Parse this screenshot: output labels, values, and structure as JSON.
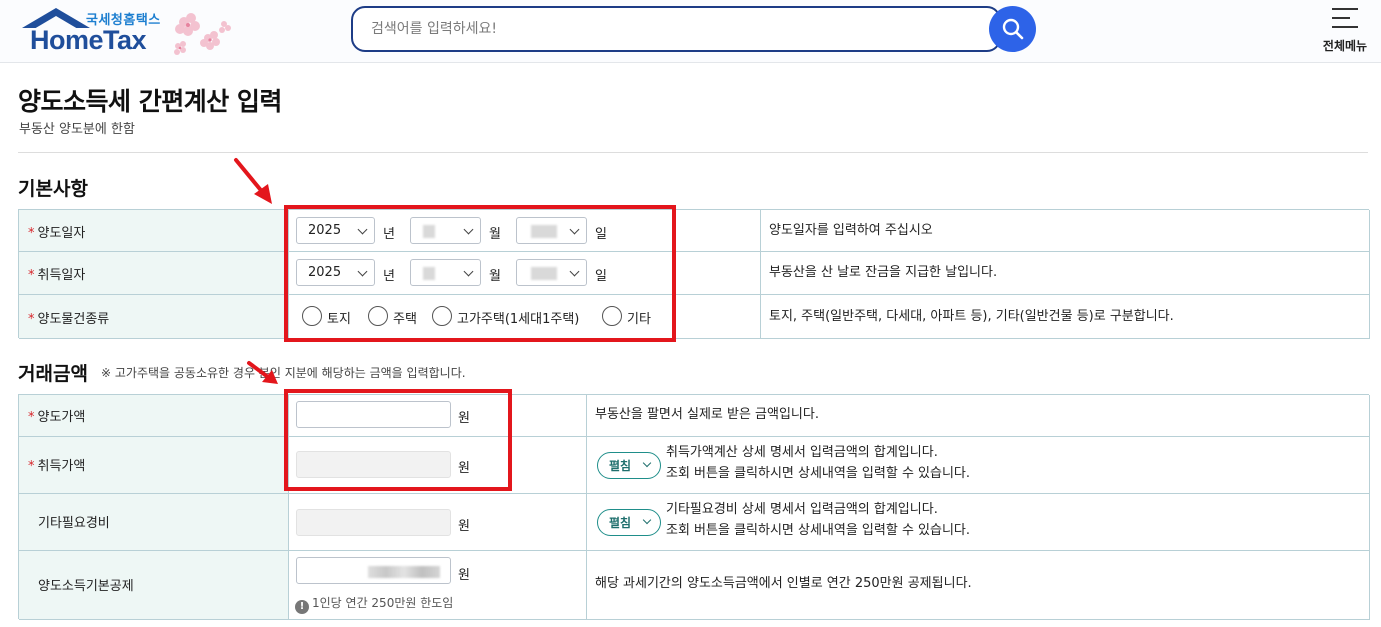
{
  "header": {
    "logo_sub": "국세청홈택스",
    "logo_text": "HomeTax",
    "search_placeholder": "검색어를 입력하세요!",
    "all_menu_label": "전체메뉴"
  },
  "page": {
    "title": "양도소득세 간편계산 입력",
    "subtitle": "부동산 양도분에 한함"
  },
  "basic": {
    "section_title": "기본사항",
    "rows": [
      {
        "label": "양도일자",
        "required": true,
        "year": "2025",
        "year_unit": "년",
        "month_unit": "월",
        "day_unit": "일",
        "desc": "양도일자를 입력하여 주십시오"
      },
      {
        "label": "취득일자",
        "required": true,
        "year": "2025",
        "year_unit": "년",
        "month_unit": "월",
        "day_unit": "일",
        "desc": "부동산을 산 날로 잔금을 지급한 날입니다."
      },
      {
        "label": "양도물건종류",
        "required": true,
        "options": [
          "토지",
          "주택",
          "고가주택(1세대1주택)",
          "기타"
        ],
        "desc": "토지, 주택(일반주택, 다세대, 아파트 등), 기타(일반건물 등)로 구분합니다."
      }
    ]
  },
  "amount": {
    "section_title": "거래금액",
    "note": "※ 고가주택을 공동소유한 경우 본인 지분에 해당하는 금액을 입력합니다.",
    "currency_unit": "원",
    "fold_label": "펼침",
    "rows": [
      {
        "label": "양도가액",
        "required": true,
        "desc": "부동산을 팔면서 실제로 받은 금액입니다."
      },
      {
        "label": "취득가액",
        "required": true,
        "desc1": "취득가액계산 상세 명세서 입력금액의 합계입니다.",
        "desc2": "조회 버튼을 클릭하시면 상세내역을 입력할 수 있습니다."
      },
      {
        "label": "기타필요경비",
        "required": false,
        "desc1": "기타필요경비 상세 명세서 입력금액의 합계입니다.",
        "desc2": "조회 버튼을 클릭하시면 상세내역을 입력할 수 있습니다."
      },
      {
        "label": "양도소득기본공제",
        "required": false,
        "limit_note": "1인당 연간 250만원 한도임",
        "desc": "해당 과세기간의 양도소득금액에서 인별로 연간 250만원 공제됩니다."
      }
    ]
  },
  "colors": {
    "brand_navy": "#1f4e9b",
    "search_blue": "#2d63e8",
    "header_cell": "#eef7f5",
    "required_mark": "#d6242a",
    "annotation_red": "#e3161c",
    "fold_teal": "#1f8e8a"
  },
  "icons": [
    "search-icon",
    "hamburger-menu-icon",
    "chevron-down-icon",
    "info-icon",
    "cherry-blossom-icon",
    "red-arrow-annotation"
  ]
}
